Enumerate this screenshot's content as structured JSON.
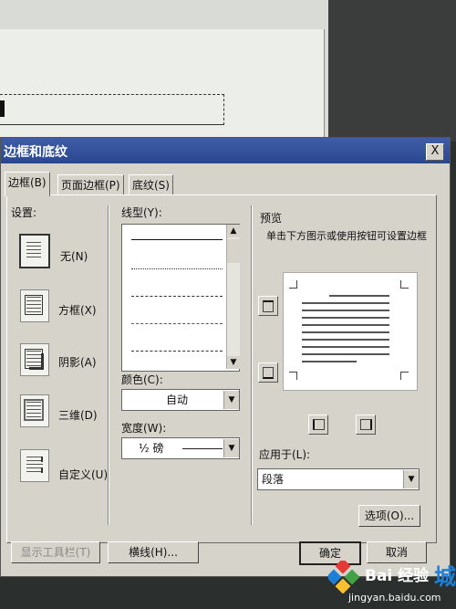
{
  "dialog": {
    "title": "边框和底纹",
    "close_label": "X"
  },
  "tabs": [
    {
      "label": "边框(B)"
    },
    {
      "label": "页面边框(P)"
    },
    {
      "label": "底纹(S)"
    }
  ],
  "settings": {
    "label": "设置:",
    "items": [
      {
        "label": "无(N)"
      },
      {
        "label": "方框(X)"
      },
      {
        "label": "阴影(A)"
      },
      {
        "label": "三维(D)"
      },
      {
        "label": "自定义(U)"
      }
    ]
  },
  "line_style": {
    "label": "线型(Y):"
  },
  "color": {
    "label": "颜色(C):",
    "value": "自动"
  },
  "width": {
    "label": "宽度(W):",
    "value": "½ 磅"
  },
  "preview": {
    "label": "预览",
    "hint": "单击下方图示或使用按钮可设置边框"
  },
  "apply_to": {
    "label": "应用于(L):",
    "value": "段落"
  },
  "buttons": {
    "options": "选项(O)...",
    "show_toolbar": "显示工具栏(T)",
    "horizontal_line": "横线(H)...",
    "ok": "确定",
    "cancel": "取消"
  },
  "watermark": {
    "brand": "Bai 经验",
    "url": "jingyan.baidu.com",
    "suffix": "城"
  },
  "colors": {
    "titlebar": "#2a4690",
    "dialog_bg": "#d6d3ca",
    "watermark_accent": "#1e7fd6"
  }
}
